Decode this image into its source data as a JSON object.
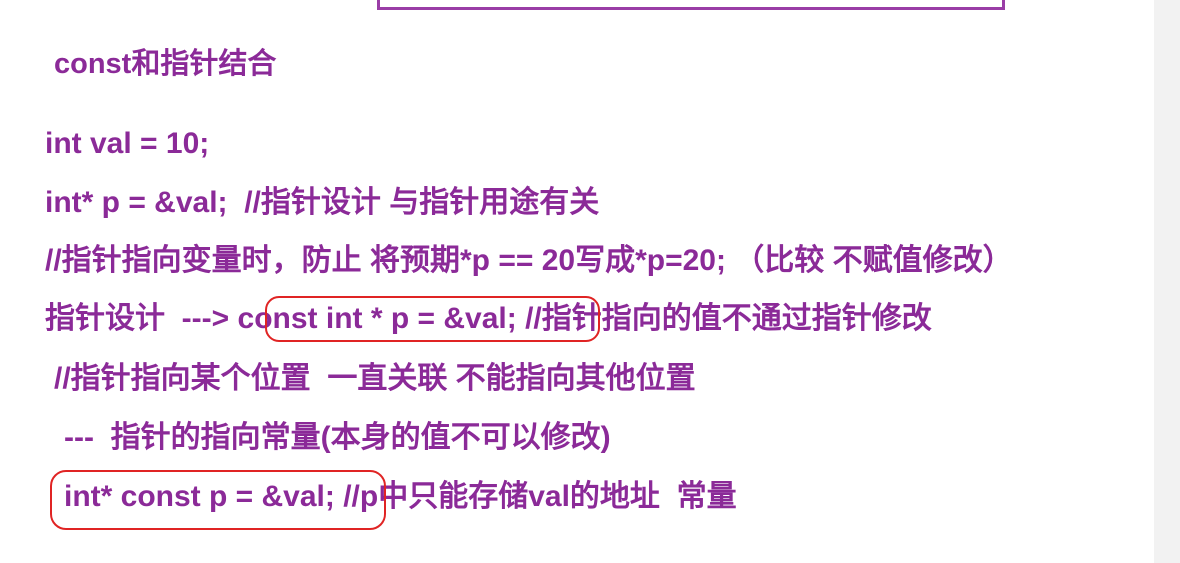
{
  "title": "const和指针结合",
  "lines": {
    "l1": "int val = 10;",
    "l2": "int* p = &val;  //指针设计 与指针用途有关",
    "l3": "//指针指向变量时，防止 将预期*p == 20写成*p=20; （比较 不赋值修改）",
    "l4_prefix": "指针设计  --->",
    "l4_boxed": "const int * p = &val;",
    "l4_suffix": " //指针指向的值不通过指针修改",
    "l5": "//指针指向某个位置  一直关联 不能指向其他位置",
    "l6": "---  指针的指向常量(本身的值不可以修改)",
    "l7_boxed": "int* const p = &val;",
    "l7_suffix": " //p中只能存储val的地址  常量"
  },
  "colors": {
    "text": "#8b2a98",
    "highlight_outline": "#e02424",
    "frame": "#9a3da6"
  }
}
